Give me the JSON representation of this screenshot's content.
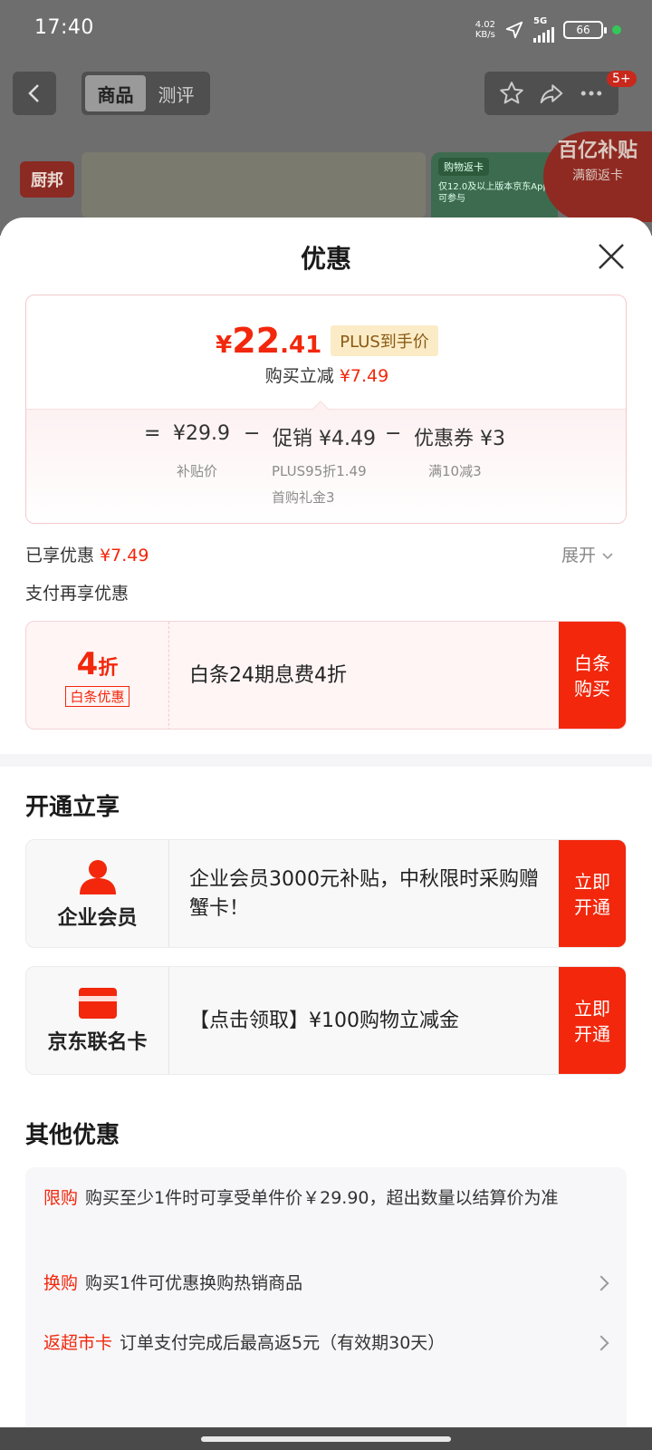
{
  "status_bar": {
    "time": "17:40",
    "net_speed_value": "4.02",
    "net_speed_unit": "KB/s",
    "network": "5G",
    "battery": "66"
  },
  "nav": {
    "tabs": [
      {
        "label": "商品"
      },
      {
        "label": "测评"
      }
    ],
    "badge": "5+"
  },
  "background_banner": {
    "logo": "厨邦",
    "card_title": "购物返卡",
    "card_text": "仅12.0及以上版本京东App可参与",
    "subsidy_title": "百亿补贴",
    "subsidy_sub": "满额返卡"
  },
  "sheet": {
    "title": "优惠",
    "price": {
      "yen": "¥",
      "integer": "22",
      "decimal": ".41",
      "tag": "PLUS到手价"
    },
    "instant": {
      "label": "购买立减",
      "amount": "¥7.49"
    },
    "calc": {
      "eq": "=",
      "minus": "−",
      "subsidy_price": "¥29.9",
      "subsidy_label": "补贴价",
      "promo": "促销 ¥4.49",
      "promo_sub1": "PLUS95折1.49",
      "promo_sub2": "首购礼金3",
      "coupon": "优惠券 ¥3",
      "coupon_sub": "满10减3"
    },
    "enjoyed": {
      "label": "已享优惠",
      "amount": "¥7.49"
    },
    "expand": "展开",
    "pay_more": "支付再享优惠",
    "baitiao": {
      "discount": "4",
      "unit": "折",
      "tag": "白条优惠",
      "text": "白条24期息费4折",
      "button": "白条购买"
    },
    "open_section": "开通立享",
    "enterprise": {
      "label": "企业会员",
      "text": "企业会员3000元补贴，中秋限时采购赠蟹卡！",
      "button": "立即开通"
    },
    "jd_card": {
      "label": "京东联名卡",
      "text": "【点击领取】¥100购物立减金",
      "button": "立即开通"
    },
    "others_title": "其他优惠",
    "others": [
      {
        "tag": "限购",
        "text": "购买至少1件时可享受单件价￥29.90，超出数量以结算价为准"
      },
      {
        "tag": "换购",
        "text": "购买1件可优惠换购热销商品"
      },
      {
        "tag": "返超市卡",
        "text": "订单支付完成后最高返5元（有效期30天）"
      }
    ]
  }
}
